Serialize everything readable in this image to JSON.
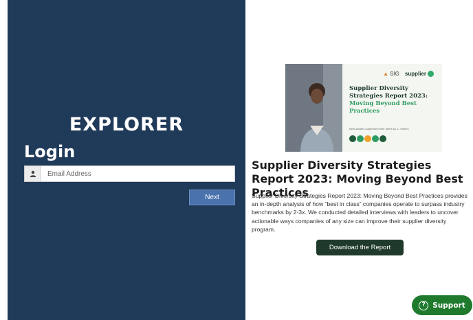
{
  "login": {
    "brand": "EXPLORER",
    "heading": "Login",
    "email_placeholder": "Email Address",
    "next_label": "Next"
  },
  "promo": {
    "image": {
      "logo_sig": "SIG",
      "logo_supplier": "supplier",
      "title_line1": "Supplier Diversity",
      "title_line2": "Strategies Report 2023:",
      "title_green1": "Moving Beyond Best",
      "title_green2": "Practices",
      "subtitle": "New leaders outperform their peers by 2–3 times",
      "dot_colors": [
        "#1f5c3a",
        "#2e9c62",
        "#f0a12a",
        "#2e9c62",
        "#1f5c3a"
      ]
    },
    "title": "Supplier Diversity Strategies Report 2023: Moving Beyond Best Practices",
    "body": "Supplier Diversity Strategies Report 2023: Moving Beyond Best Practices provides an in-depth analysis of how “best in class” companies operate to surpass industry benchmarks by 2-3x. We conducted detailed interviews with leaders to uncover actionable ways companies of any size can improve their supplier diversity program.",
    "download_label": "Download the Report"
  },
  "support": {
    "label": "Support",
    "icon": "question-circle-icon"
  },
  "colors": {
    "login_panel": "#203a5a",
    "next_button": "#4a72ad",
    "download_button": "#1f3a2d",
    "support_button": "#1f7a2e"
  }
}
